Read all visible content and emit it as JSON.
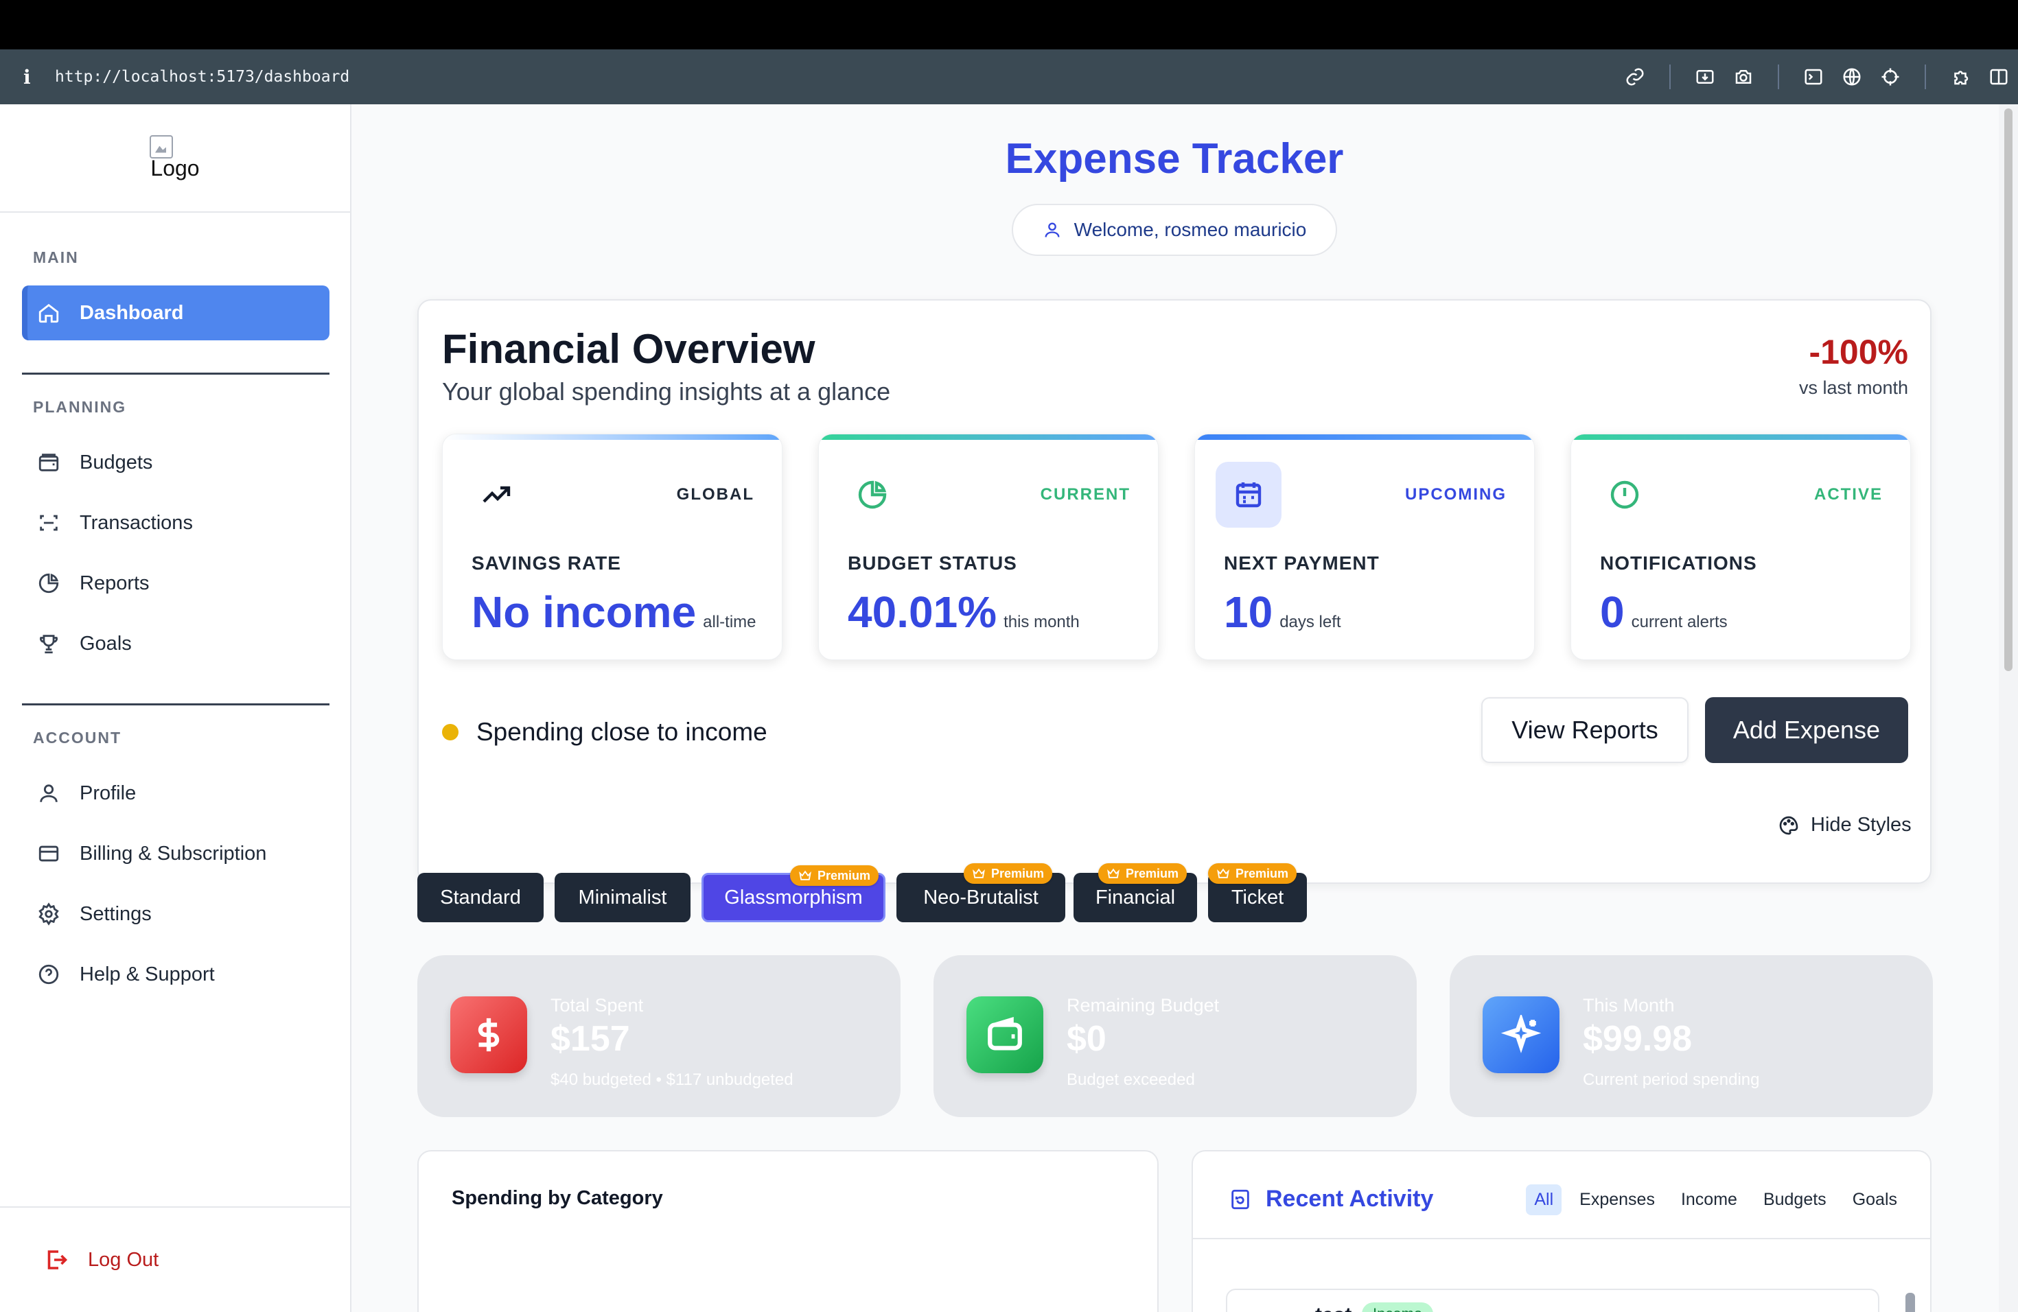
{
  "browser": {
    "url": "http://localhost:5173/dashboard"
  },
  "sidebar": {
    "logo_alt": "Logo",
    "sections": {
      "main": "MAIN",
      "planning": "PLANNING",
      "account": "ACCOUNT"
    },
    "items": {
      "dashboard": "Dashboard",
      "budgets": "Budgets",
      "transactions": "Transactions",
      "reports": "Reports",
      "goals": "Goals",
      "profile": "Profile",
      "billing": "Billing & Subscription",
      "settings": "Settings",
      "help": "Help & Support"
    },
    "logout": "Log Out"
  },
  "header": {
    "title": "Expense Tracker",
    "welcome": "Welcome, rosmeo mauricio"
  },
  "overview": {
    "title": "Financial Overview",
    "subtitle": "Your global spending insights at a glance",
    "change": "-100%",
    "change_label": "vs last month",
    "cards": [
      {
        "tag": "GLOBAL",
        "label": "SAVINGS RATE",
        "value": "No income",
        "suffix": "all-time",
        "icon": "trending-up-icon"
      },
      {
        "tag": "CURRENT",
        "label": "BUDGET STATUS",
        "value": "40.01%",
        "suffix": "this month",
        "icon": "pie-chart-icon"
      },
      {
        "tag": "UPCOMING",
        "label": "NEXT PAYMENT",
        "value": "10",
        "suffix": "days left",
        "icon": "calendar-icon"
      },
      {
        "tag": "ACTIVE",
        "label": "NOTIFICATIONS",
        "value": "0",
        "suffix": "current alerts",
        "icon": "alert-circle-icon"
      }
    ],
    "status": "Spending close to income",
    "view_reports": "View Reports",
    "add_expense": "Add Expense"
  },
  "styles": {
    "toggle": "Hide Styles",
    "premium_label": "Premium",
    "options": [
      "Standard",
      "Minimalist",
      "Glassmorphism",
      "Neo-Brutalist",
      "Financial",
      "Ticket"
    ],
    "active": "Glassmorphism"
  },
  "stats": [
    {
      "title": "Total Spent",
      "value": "$157",
      "sub": "$40 budgeted • $117 unbudgeted",
      "icon": "dollar-icon",
      "color": "#ef4444"
    },
    {
      "title": "Remaining Budget",
      "value": "$0",
      "sub": "Budget exceeded",
      "icon": "wallet-icon",
      "color": "#22a06b"
    },
    {
      "title": "This Month",
      "value": "$99.98",
      "sub": "Current period spending",
      "icon": "sparkles-icon",
      "color": "#3b82f6"
    }
  ],
  "spending": {
    "title": "Spending by Category"
  },
  "activity": {
    "title": "Recent Activity",
    "tabs": [
      "All",
      "Expenses",
      "Income",
      "Budgets",
      "Goals"
    ],
    "active_tab": "All",
    "first_item": {
      "name": "test",
      "badge": "Income"
    }
  },
  "colors": {
    "accent": "#3548e0",
    "danger": "#b91c1c",
    "sidebar_active": "#4f86ee",
    "premium": "#f59e0b"
  }
}
